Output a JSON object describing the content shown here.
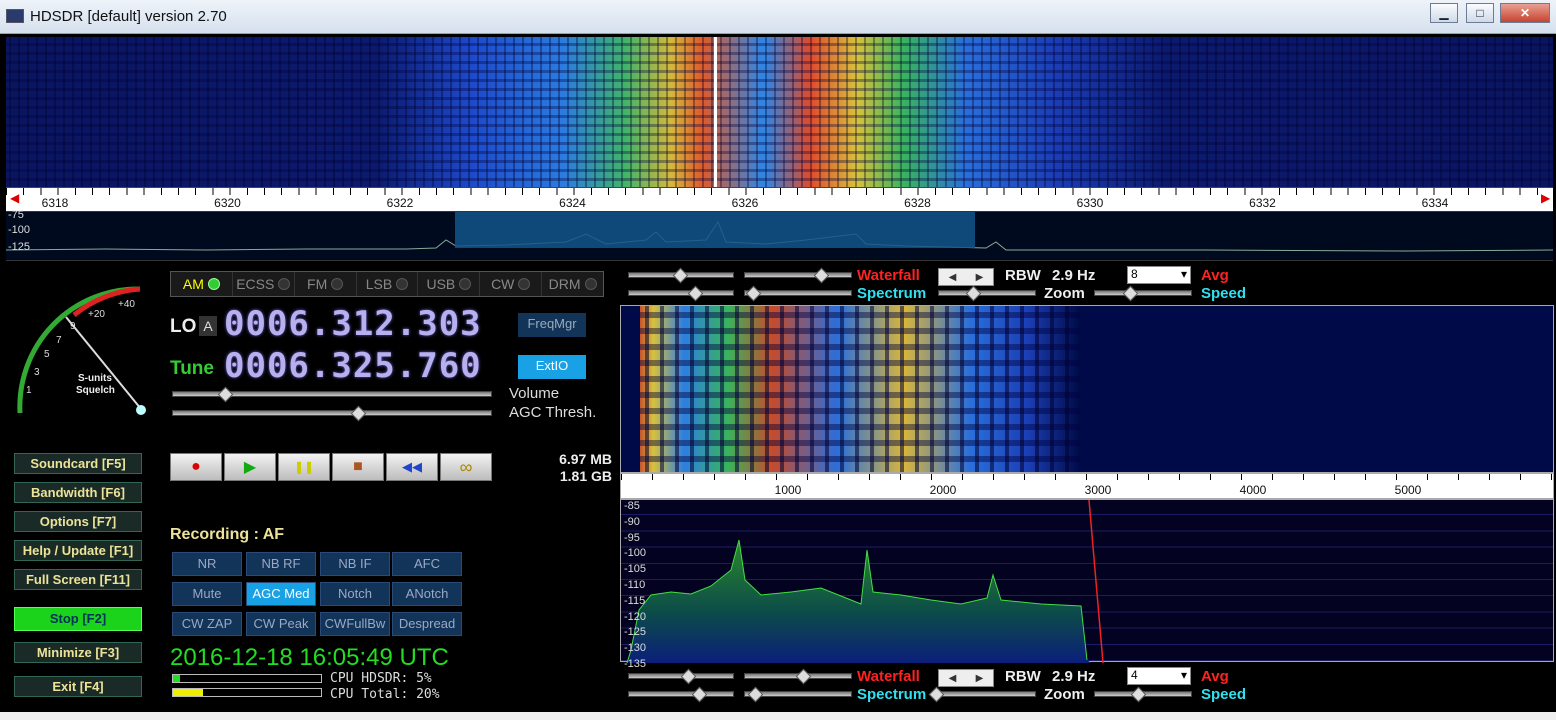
{
  "window": {
    "title": "HDSDR [default]  version 2.70",
    "min": "▁",
    "max": "□",
    "close": "✕"
  },
  "top_waterfall": {
    "ticks": [
      "6318",
      "6320",
      "6322",
      "6324",
      "6326",
      "6328",
      "6330",
      "6332",
      "6334"
    ],
    "db_labels": [
      "-75",
      "-100",
      "-125"
    ]
  },
  "smeter": {
    "scale": [
      "1",
      "3",
      "5",
      "7",
      "9",
      "+20",
      "+40"
    ],
    "label1": "S-units",
    "label2": "Squelch"
  },
  "modes": [
    {
      "label": "AM",
      "active": true
    },
    {
      "label": "ECSS"
    },
    {
      "label": "FM"
    },
    {
      "label": "LSB"
    },
    {
      "label": "USB"
    },
    {
      "label": "CW"
    },
    {
      "label": "DRM"
    }
  ],
  "lo": {
    "label": "LO",
    "lock": "A",
    "value": "0006.312.303"
  },
  "tune": {
    "label": "Tune",
    "value": "0006.325.760"
  },
  "buttons": {
    "freqmgr": "FreqMgr",
    "extio": "ExtIO"
  },
  "sliders": {
    "volume": "Volume",
    "agc": "AGC Thresh."
  },
  "transport": {
    "record": "●",
    "play": "▶",
    "pause": "❚❚",
    "stop": "■",
    "rewind": "◀◀",
    "loop": "∞"
  },
  "storage": {
    "size": "6.97 MB",
    "free": "1.81 GB"
  },
  "recording": "Recording : AF",
  "menu": [
    "Soundcard  [F5]",
    "Bandwidth  [F6]",
    "Options  [F7]",
    "Help / Update  [F1]",
    "Full Screen  [F11]",
    "Stop  [F2]",
    "Minimize  [F3]",
    "Exit  [F4]"
  ],
  "dsp": [
    [
      "NR",
      "NB RF",
      "NB IF",
      "AFC"
    ],
    [
      "Mute",
      "AGC Med",
      "Notch",
      "ANotch"
    ],
    [
      "CW ZAP",
      "CW Peak",
      "CWFullBw",
      "Despread"
    ]
  ],
  "datetime": "2016-12-18   16:05:49 UTC",
  "cpu": {
    "hdsdr": "CPU HDSDR:  5%",
    "total": "CPU Total: 20%"
  },
  "upper_ctrl": {
    "waterfall": "Waterfall",
    "spectrum": "Spectrum",
    "rbw_label": "RBW",
    "rbw": "2.9 Hz",
    "zoom": "Zoom",
    "combo": "8",
    "avg": "Avg",
    "speed": "Speed"
  },
  "lower_ctrl": {
    "waterfall": "Waterfall",
    "spectrum": "Spectrum",
    "rbw_label": "RBW",
    "rbw": "2.9 Hz",
    "zoom": "Zoom",
    "combo": "4",
    "avg": "Avg",
    "speed": "Speed"
  },
  "audio": {
    "ticks": [
      "1000",
      "2000",
      "3000",
      "4000",
      "5000"
    ],
    "db_labels": [
      "-85",
      "-90",
      "-95",
      "-100",
      "-105",
      "-110",
      "-115",
      "-120",
      "-125",
      "-130",
      "-135"
    ]
  },
  "colors": {
    "accent": "#19a1e6",
    "digits": "#b7b0ee",
    "menu_text": "#ede398",
    "stop_bg": "#1bd31b"
  }
}
